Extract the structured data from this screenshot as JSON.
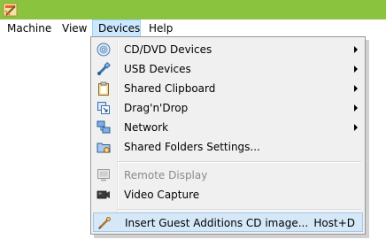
{
  "menubar": {
    "items": [
      {
        "label": "Machine"
      },
      {
        "label": "View"
      },
      {
        "label": "Devices",
        "active": true
      },
      {
        "label": "Help"
      }
    ]
  },
  "devices_menu": {
    "items": [
      {
        "label": "CD/DVD Devices",
        "icon": "cd-dvd-icon",
        "submenu": true
      },
      {
        "label": "USB Devices",
        "icon": "usb-icon",
        "submenu": true
      },
      {
        "label": "Shared Clipboard",
        "icon": "clipboard-icon",
        "submenu": true
      },
      {
        "label": "Drag'n'Drop",
        "icon": "drag-drop-icon",
        "submenu": true
      },
      {
        "label": "Network",
        "icon": "network-icon",
        "submenu": true
      },
      {
        "label": "Shared Folders Settings...",
        "icon": "shared-folders-icon",
        "submenu": false
      },
      {
        "label": "Remote Display",
        "icon": "remote-display-icon",
        "disabled": true
      },
      {
        "label": "Video Capture",
        "icon": "video-capture-icon"
      },
      {
        "label": "Insert Guest Additions CD image...",
        "icon": "guest-additions-icon",
        "shortcut": "Host+D",
        "highlighted": true
      }
    ]
  },
  "colors": {
    "titlebar": "#8ac43f",
    "menu_highlight": "#d5e8f8",
    "menubar_active": "#cce8ff"
  }
}
